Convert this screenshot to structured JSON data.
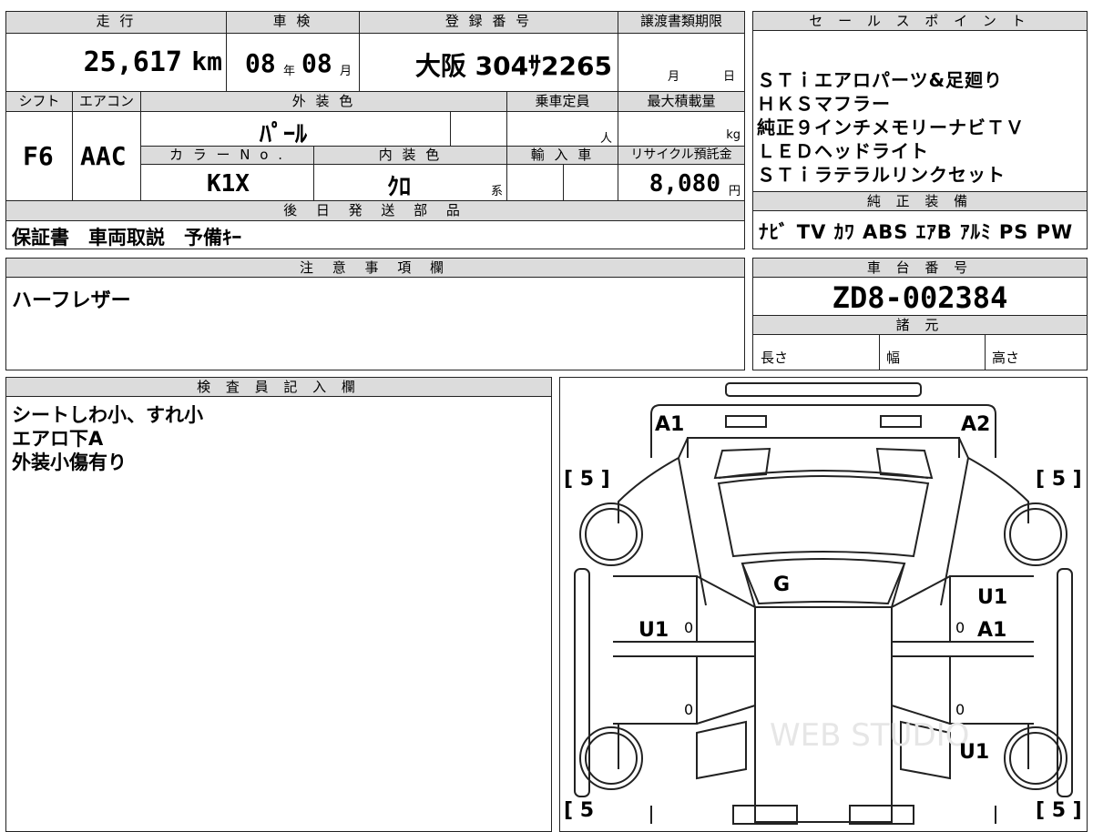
{
  "top": {
    "h_mileage": "走 行",
    "h_inspection": "車 検",
    "h_reg": "登 録 番 号",
    "h_transfer": "譲渡書類期限",
    "mileage": "25,617",
    "mileage_unit": "km",
    "insp_year": "08",
    "insp_year_unit": "年",
    "insp_month": "08",
    "insp_month_unit": "月",
    "reg_number": "大阪 304ｻ2265",
    "transfer_month": "月",
    "transfer_day": "日"
  },
  "mid": {
    "h_shift": "シフト",
    "h_ac": "エアコン",
    "h_ext_color": "外 装 色",
    "h_capacity": "乗車定員",
    "h_max_load": "最大積載量",
    "shift": "F6",
    "ac": "AAC",
    "ext_color": "ﾊﾟｰﾙ",
    "capacity_unit": "人",
    "load_unit": "kg",
    "h_color_no": "カ ラ ー N o .",
    "h_int_color": "内 装 色",
    "h_import": "輸 入 車",
    "h_recycle": "リサイクル預託金",
    "color_no": "K1X",
    "int_color": "ｸﾛ",
    "int_suffix": "系",
    "recycle_fee": "8,080",
    "recycle_unit": "円"
  },
  "later_ship": {
    "header": "後 日 発 送 部 品",
    "value": "保証書　車両取説　予備ｷｰ"
  },
  "sales_point": {
    "header": "セ ー ル ス ポ イ ン ト",
    "lines": [
      "ＳＴｉエアロパーツ&足廻り",
      "ＨＫＳマフラー",
      "純正９インチメモリーナビＴＶ",
      "ＬＥＤヘッドライト",
      "ＳＴｉラテラルリンクセット"
    ]
  },
  "equipment": {
    "header": "純 正 装 備",
    "value": "ﾅﾋﾞ TV ｶﾜ ABS ｴｱB ｱﾙﾐ PS PW"
  },
  "notes": {
    "header": "注 意 事 項 欄",
    "value": "ハーフレザー"
  },
  "chassis": {
    "header": "車 台 番 号",
    "value": "ZD8-002384"
  },
  "spec": {
    "header": "諸 元",
    "length": "長さ",
    "width": "幅",
    "height": "高さ"
  },
  "inspector": {
    "header": "検 査 員 記 入 欄",
    "lines": [
      "シートしわ小、すれ小",
      "エアロ下A",
      "外装小傷有り"
    ]
  },
  "diagram": {
    "marks": {
      "front_left": "A1",
      "front_right": "A2",
      "roof": "G",
      "left_door": "U1",
      "right_door_upper": "U1",
      "right_door_lower": "A1",
      "right_rear": "U1"
    },
    "tires": {
      "fl": "[ 5 ]",
      "fr": "[ 5 ]",
      "rl": "[ 5",
      "rr": "[ 5 ]"
    },
    "zeros": {
      "a": "0",
      "b": "0",
      "c": "0",
      "d": "0"
    },
    "watermark": "WEB STUDIO"
  }
}
